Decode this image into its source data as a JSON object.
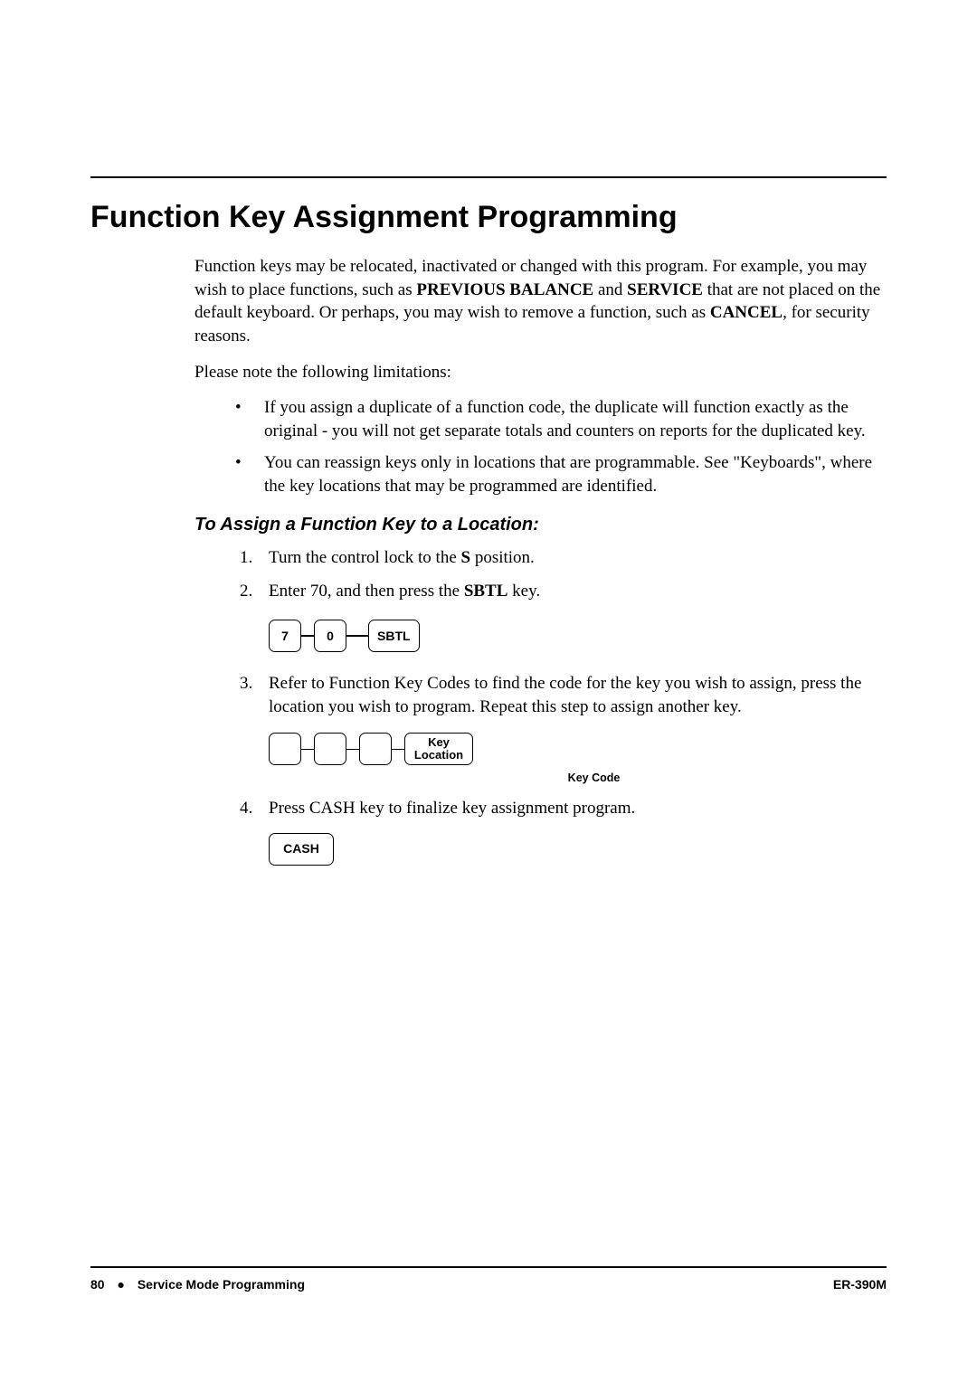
{
  "section_title": "Function Key Assignment Programming",
  "intro": {
    "prefix": "Function keys may be relocated, inactivated or changed with this program. For example, you may wish to place functions, such as ",
    "bold1": "PREVIOUS BALANCE",
    "mid1": " and ",
    "bold2": "SERVICE",
    "mid2": " that are not placed on the default keyboard. Or perhaps, you may wish to remove a function, such as ",
    "bold3": "CANCEL",
    "suffix": ", for security reasons."
  },
  "note_intro": "Please note the following limitations:",
  "bullets": [
    "If you assign a duplicate of a function code, the duplicate will function exactly as the original - you will not get separate totals and counters on reports for the duplicated key.",
    "You can reassign keys only in locations that are programmable.    See \"Keyboards\", where the key locations that may be programmed are identified."
  ],
  "subheading": "To Assign a Function Key to a Location:",
  "steps": {
    "s1": {
      "num": "1.",
      "prefix": "Turn the control lock to the ",
      "bold": "S",
      "suffix": " position."
    },
    "s2": {
      "num": "2.",
      "prefix": "Enter 70, and then press the ",
      "bold": "SBTL",
      "suffix": " key."
    },
    "s3": {
      "num": "3.",
      "text": "Refer to Function Key Codes to find the code for the key you wish to assign, press the location you wish to program.    Repeat this step to assign another key."
    },
    "s4": {
      "num": "4.",
      "text": "Press CASH key to finalize key assignment program."
    }
  },
  "keys": {
    "k7": "7",
    "k0": "0",
    "sbtl": "SBTL",
    "key_location_line1": "Key",
    "key_location_line2": "Location",
    "key_code_label": "Key Code",
    "cash": "CASH"
  },
  "footer": {
    "page_num": "80",
    "dot": "●",
    "section": "Service Mode Programming",
    "model": "ER-390M"
  }
}
